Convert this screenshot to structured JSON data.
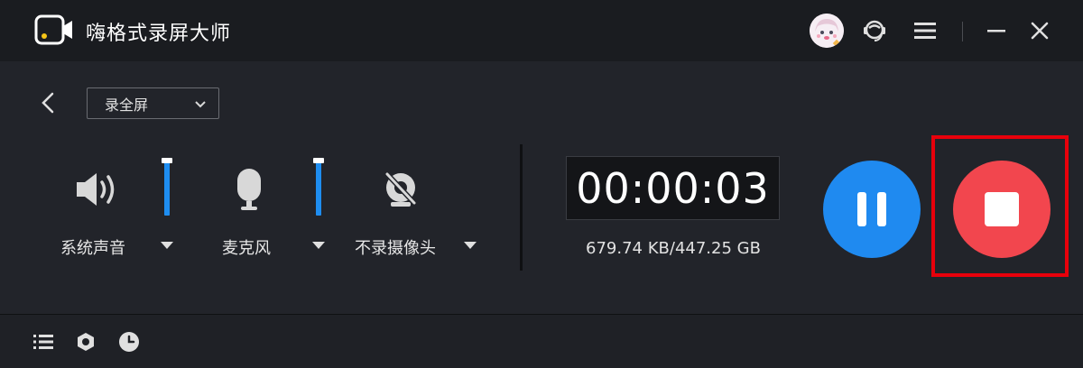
{
  "app": {
    "title": "嗨格式录屏大师",
    "logo_icon": "video-camera-icon"
  },
  "titlebar": {
    "avatar_icon": "user-avatar-icon",
    "support_icon": "customer-service-icon",
    "menu_icon": "hamburger-menu-icon",
    "minimize_icon": "minimize-icon",
    "close_icon": "close-icon"
  },
  "toolbar": {
    "back_icon": "chevron-left-icon",
    "mode_select": {
      "value": "录全屏",
      "icon": "chevron-down-icon"
    }
  },
  "sources": [
    {
      "label": "系统声音",
      "icon": "speaker-icon",
      "volume_fraction": 1.0
    },
    {
      "label": "麦克风",
      "icon": "microphone-icon",
      "volume_fraction": 1.0
    },
    {
      "label": "不录摄像头",
      "icon": "camera-off-icon"
    }
  ],
  "recording": {
    "timer": "00:00:03",
    "file_size": "679.74 KB/447.25 GB"
  },
  "controls": {
    "pause_icon": "pause-icon",
    "stop_icon": "stop-icon"
  },
  "bottombar": {
    "list_icon": "list-icon",
    "settings_icon": "hexagon-settings-icon",
    "schedule_icon": "clock-icon"
  },
  "colors": {
    "accent_blue": "#1f8af0",
    "stop_red": "#f2464e",
    "highlight_red": "#e8000b",
    "background": "#22242a"
  }
}
